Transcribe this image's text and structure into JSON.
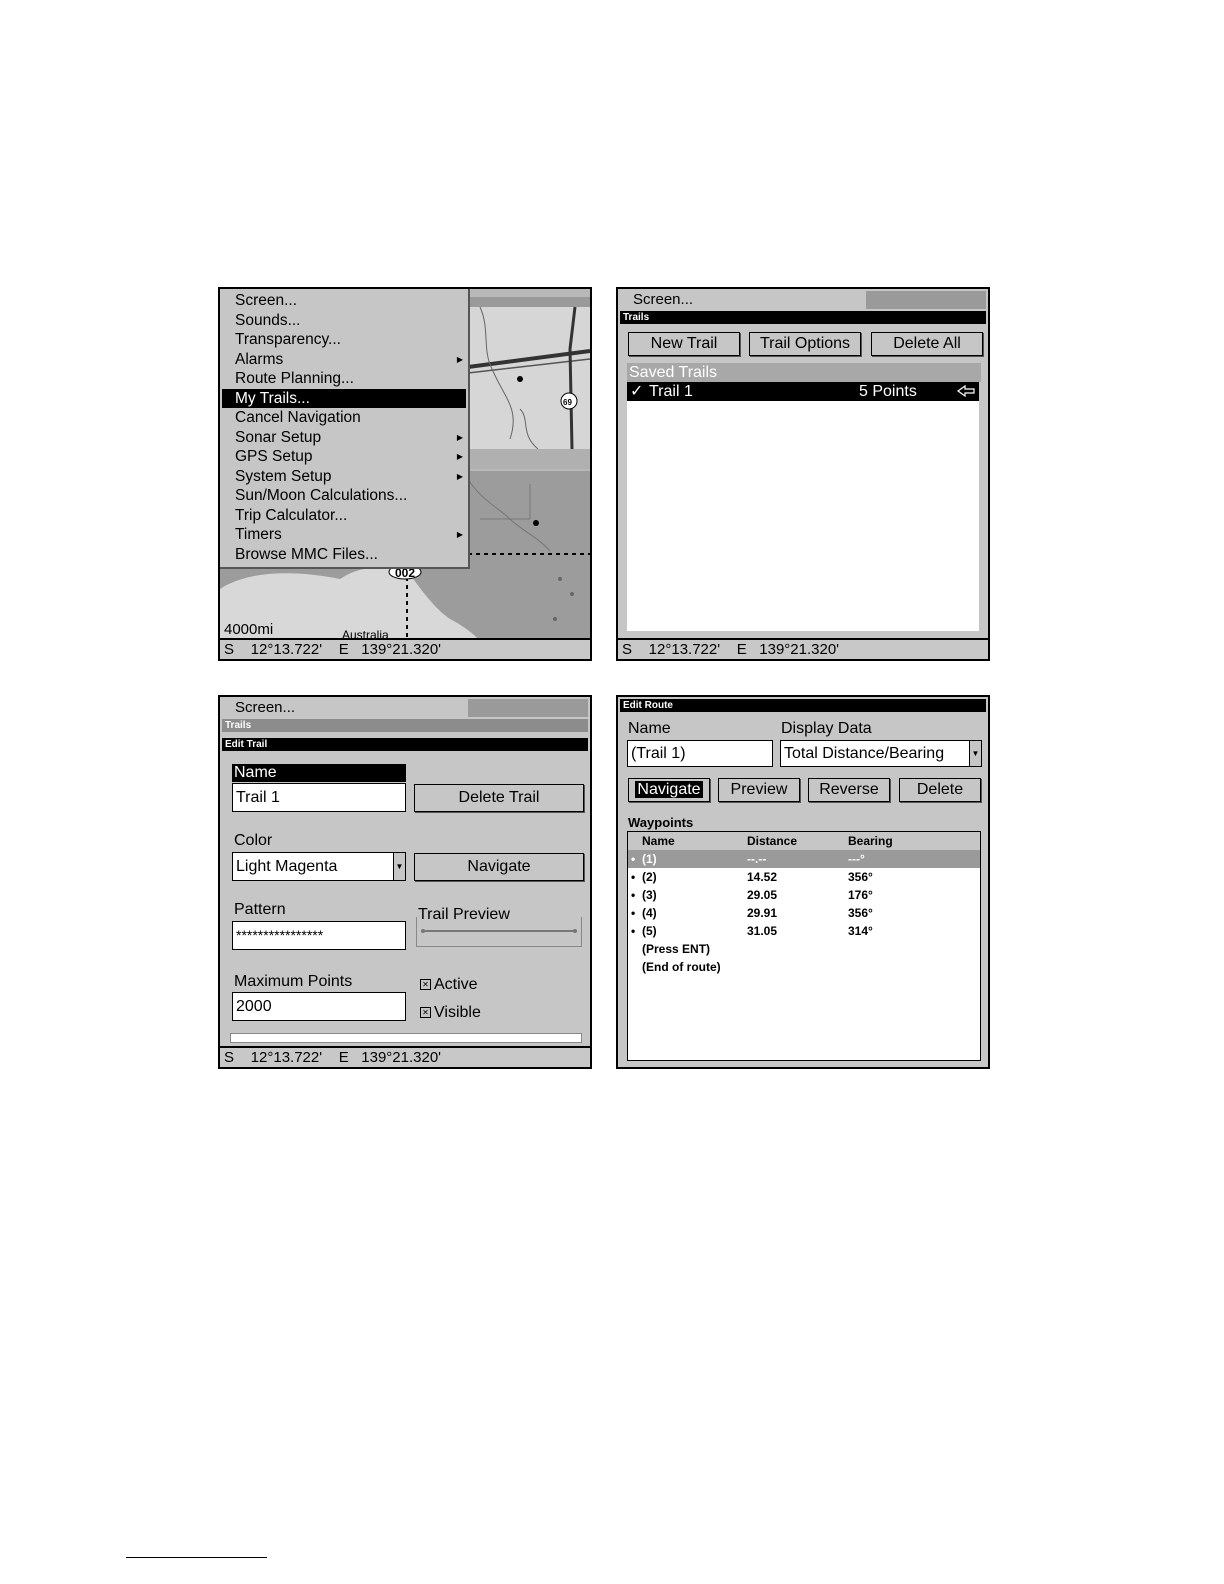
{
  "map_panel": {
    "menu_items": [
      {
        "label": "Screen...",
        "submenu": false,
        "selected": false
      },
      {
        "label": "Sounds...",
        "submenu": false,
        "selected": false
      },
      {
        "label": "Transparency...",
        "submenu": false,
        "selected": false
      },
      {
        "label": "Alarms",
        "submenu": true,
        "selected": false
      },
      {
        "label": "Route Planning...",
        "submenu": false,
        "selected": false
      },
      {
        "label": "My Trails...",
        "submenu": false,
        "selected": true
      },
      {
        "label": "Cancel Navigation",
        "submenu": false,
        "selected": false
      },
      {
        "label": "Sonar Setup",
        "submenu": true,
        "selected": false
      },
      {
        "label": "GPS Setup",
        "submenu": true,
        "selected": false
      },
      {
        "label": "System Setup",
        "submenu": true,
        "selected": false
      },
      {
        "label": "Sun/Moon Calculations...",
        "submenu": false,
        "selected": false
      },
      {
        "label": "Trip Calculator...",
        "submenu": false,
        "selected": false
      },
      {
        "label": "Timers",
        "submenu": true,
        "selected": false
      },
      {
        "label": "Browse MMC Files...",
        "submenu": false,
        "selected": false
      }
    ],
    "map_labels": {
      "waypoint": "002",
      "scale": "4000mi",
      "country": "Australia",
      "highway": "69"
    },
    "status": "S    12°13.722'    E   139°21.320'"
  },
  "trails_panel": {
    "screen_title": "Screen...",
    "dialog_title": "Trails",
    "buttons": {
      "new_trail": "New Trail",
      "trail_options": "Trail Options",
      "delete_all": "Delete All"
    },
    "saved_trails_header": "Saved Trails",
    "trails": [
      {
        "name": "Trail 1",
        "points": "5 Points",
        "check": "✓"
      }
    ],
    "status": "S    12°13.722'    E   139°21.320'"
  },
  "edit_trail_panel": {
    "screen_title": "Screen...",
    "trails_title": "Trails",
    "dialog_title": "Edit Trail",
    "name_label": "Name",
    "name_value": "Trail 1",
    "delete_button": "Delete Trail",
    "color_label": "Color",
    "color_value": "Light Magenta",
    "navigate_button": "Navigate",
    "pattern_label": "Pattern",
    "pattern_value": "****************",
    "trail_preview_label": "Trail Preview",
    "max_points_label": "Maximum Points",
    "max_points_value": "2000",
    "active_label": "Active",
    "visible_label": "Visible",
    "active_checked": true,
    "visible_checked": true,
    "status": "S    12°13.722'    E   139°21.320'"
  },
  "edit_route_panel": {
    "dialog_title": "Edit Route",
    "name_label": "Name",
    "name_value": "(Trail 1)",
    "display_data_label": "Display Data",
    "display_data_value": "Total Distance/Bearing",
    "buttons": {
      "navigate": "Navigate",
      "preview": "Preview",
      "reverse": "Reverse",
      "delete": "Delete"
    },
    "waypoints_label": "Waypoints",
    "columns": {
      "name": "Name",
      "distance": "Distance",
      "bearing": "Bearing"
    },
    "rows": [
      {
        "name": "(1)",
        "distance": "--.--",
        "bearing": "---°",
        "highlight": true
      },
      {
        "name": "(2)",
        "distance": "14.52",
        "bearing": "356°",
        "highlight": false
      },
      {
        "name": "(3)",
        "distance": "29.05",
        "bearing": "176°",
        "highlight": false
      },
      {
        "name": "(4)",
        "distance": "29.91",
        "bearing": "356°",
        "highlight": false
      },
      {
        "name": "(5)",
        "distance": "31.05",
        "bearing": "314°",
        "highlight": false
      }
    ],
    "footer_rows": [
      "(Press ENT)",
      "(End of route)"
    ]
  }
}
